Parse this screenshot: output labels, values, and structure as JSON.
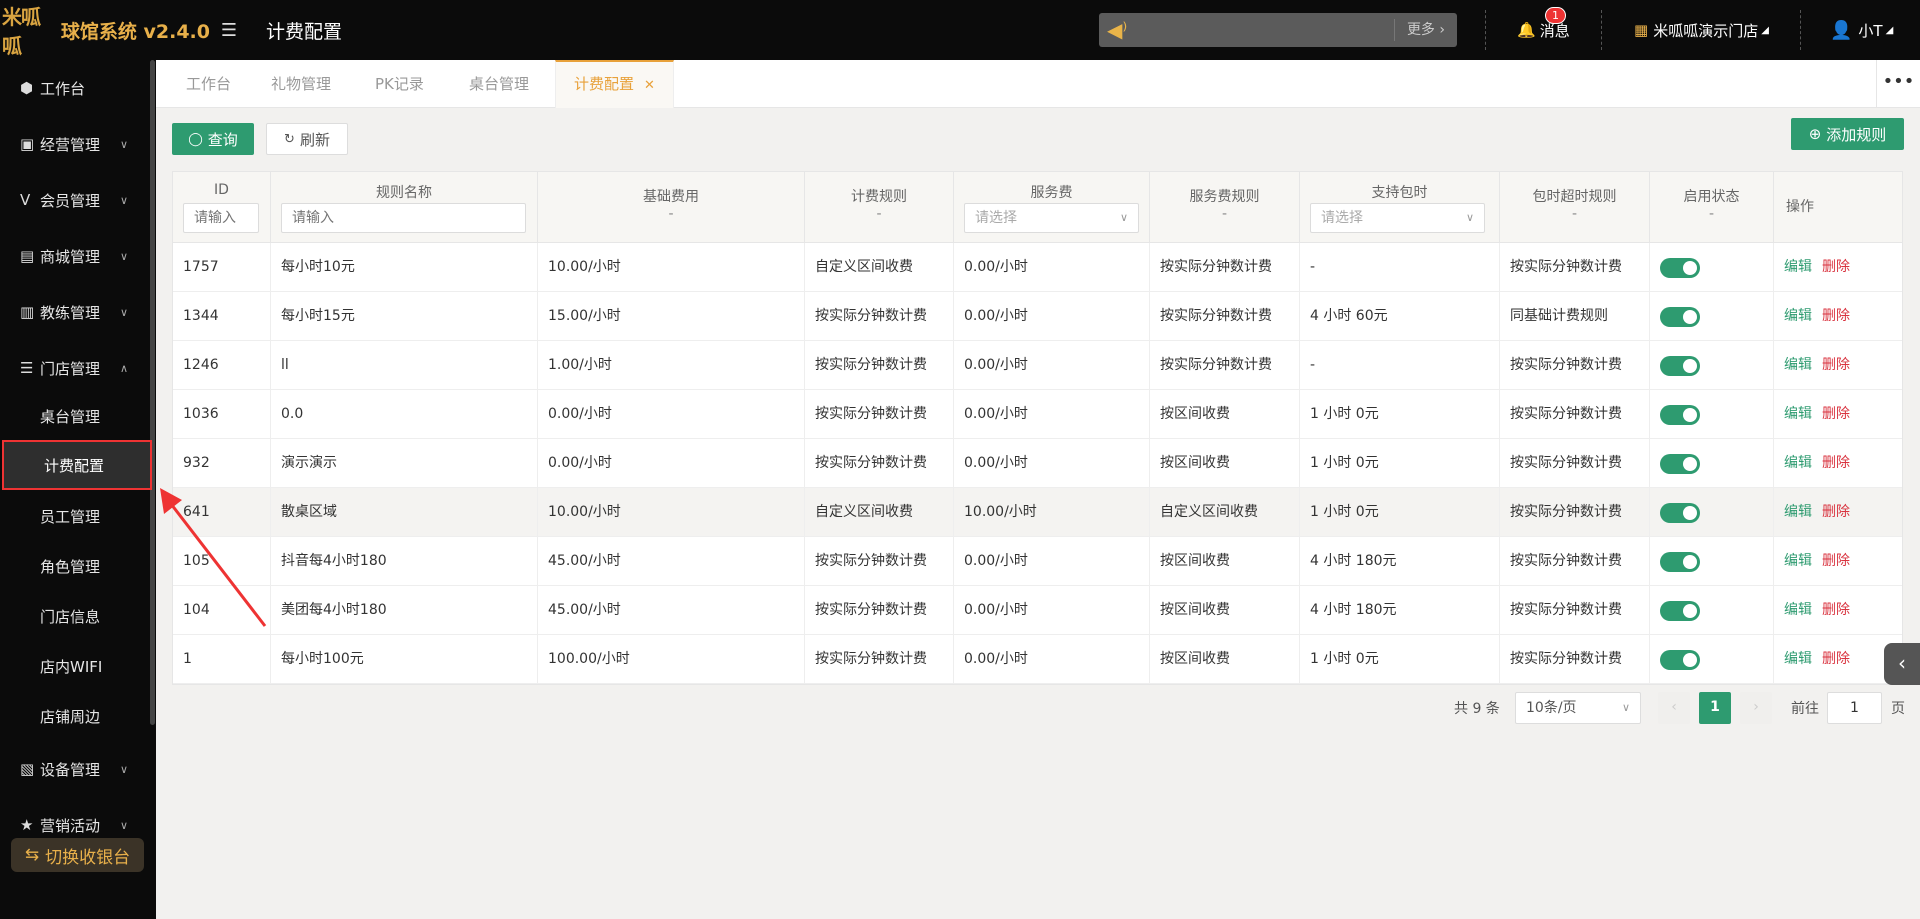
{
  "app": {
    "logo_text": "米呱呱",
    "name": "球馆系统 v2.4.0",
    "page_title": "计费配置"
  },
  "topbar": {
    "more": "更多",
    "messages": "消息",
    "message_count": "1",
    "store": "米呱呱演示门店",
    "user": "小T"
  },
  "sidebar": {
    "items": [
      {
        "label": "工作台"
      },
      {
        "label": "经营管理"
      },
      {
        "label": "会员管理"
      },
      {
        "label": "商城管理"
      },
      {
        "label": "教练管理"
      },
      {
        "label": "门店管理"
      },
      {
        "label": "设备管理"
      },
      {
        "label": "营销活动"
      }
    ],
    "sub_items": [
      {
        "label": "桌台管理"
      },
      {
        "label": "计费配置"
      },
      {
        "label": "员工管理"
      },
      {
        "label": "角色管理"
      },
      {
        "label": "门店信息"
      },
      {
        "label": "店内WIFI"
      },
      {
        "label": "店铺周边"
      }
    ],
    "switch_label": "切换收银台"
  },
  "tabs": [
    {
      "label": "工作台"
    },
    {
      "label": "礼物管理"
    },
    {
      "label": "PK记录"
    },
    {
      "label": "桌台管理"
    },
    {
      "label": "计费配置"
    }
  ],
  "toolbar": {
    "query": "查询",
    "refresh": "刷新",
    "add_rule": "添加规则"
  },
  "table": {
    "headers": {
      "id": "ID",
      "name": "规则名称",
      "base_fee": "基础费用",
      "billing_rule": "计费规则",
      "service_fee": "服务费",
      "service_rule": "服务费规则",
      "package": "支持包时",
      "overtime_rule": "包时超时规则",
      "status": "启用状态",
      "ops": "操作",
      "dash": "-"
    },
    "placeholders": {
      "input": "请输入",
      "select": "请选择"
    },
    "rows": [
      {
        "id": "1757",
        "name": "每小时10元",
        "base_fee": "10.00/小时",
        "billing_rule": "自定义区间收费",
        "service_fee": "0.00/小时",
        "service_rule": "按实际分钟数计费",
        "package": "-",
        "overtime_rule": "按实际分钟数计费"
      },
      {
        "id": "1344",
        "name": "每小时15元",
        "base_fee": "15.00/小时",
        "billing_rule": "按实际分钟数计费",
        "service_fee": "0.00/小时",
        "service_rule": "按实际分钟数计费",
        "package": "4 小时 60元",
        "overtime_rule": "同基础计费规则"
      },
      {
        "id": "1246",
        "name": "ll",
        "base_fee": "1.00/小时",
        "billing_rule": "按实际分钟数计费",
        "service_fee": "0.00/小时",
        "service_rule": "按实际分钟数计费",
        "package": "-",
        "overtime_rule": "按实际分钟数计费"
      },
      {
        "id": "1036",
        "name": "0.0",
        "base_fee": "0.00/小时",
        "billing_rule": "按实际分钟数计费",
        "service_fee": "0.00/小时",
        "service_rule": "按区间收费",
        "package": "1 小时 0元",
        "overtime_rule": "按实际分钟数计费"
      },
      {
        "id": "932",
        "name": "演示演示",
        "base_fee": "0.00/小时",
        "billing_rule": "按实际分钟数计费",
        "service_fee": "0.00/小时",
        "service_rule": "按区间收费",
        "package": "1 小时 0元",
        "overtime_rule": "按实际分钟数计费"
      },
      {
        "id": "641",
        "name": "散桌区域",
        "base_fee": "10.00/小时",
        "billing_rule": "自定义区间收费",
        "service_fee": "10.00/小时",
        "service_rule": "自定义区间收费",
        "package": "1 小时 0元",
        "overtime_rule": "按实际分钟数计费"
      },
      {
        "id": "105",
        "name": "抖音每4小时180",
        "base_fee": "45.00/小时",
        "billing_rule": "按实际分钟数计费",
        "service_fee": "0.00/小时",
        "service_rule": "按区间收费",
        "package": "4 小时 180元",
        "overtime_rule": "按实际分钟数计费"
      },
      {
        "id": "104",
        "name": "美团每4小时180",
        "base_fee": "45.00/小时",
        "billing_rule": "按实际分钟数计费",
        "service_fee": "0.00/小时",
        "service_rule": "按区间收费",
        "package": "4 小时 180元",
        "overtime_rule": "按实际分钟数计费"
      },
      {
        "id": "1",
        "name": "每小时100元",
        "base_fee": "100.00/小时",
        "billing_rule": "按实际分钟数计费",
        "service_fee": "0.00/小时",
        "service_rule": "按区间收费",
        "package": "1 小时 0元",
        "overtime_rule": "按实际分钟数计费"
      }
    ],
    "edit": "编辑",
    "delete": "删除"
  },
  "pagination": {
    "total": "共 9 条",
    "page_size": "10条/页",
    "current": "1",
    "goto_label": "前往",
    "goto_value": "1",
    "page_suffix": "页"
  },
  "colors": {
    "accent": "#e8a13a",
    "primary": "#2e9b70",
    "danger": "#d9333f"
  }
}
